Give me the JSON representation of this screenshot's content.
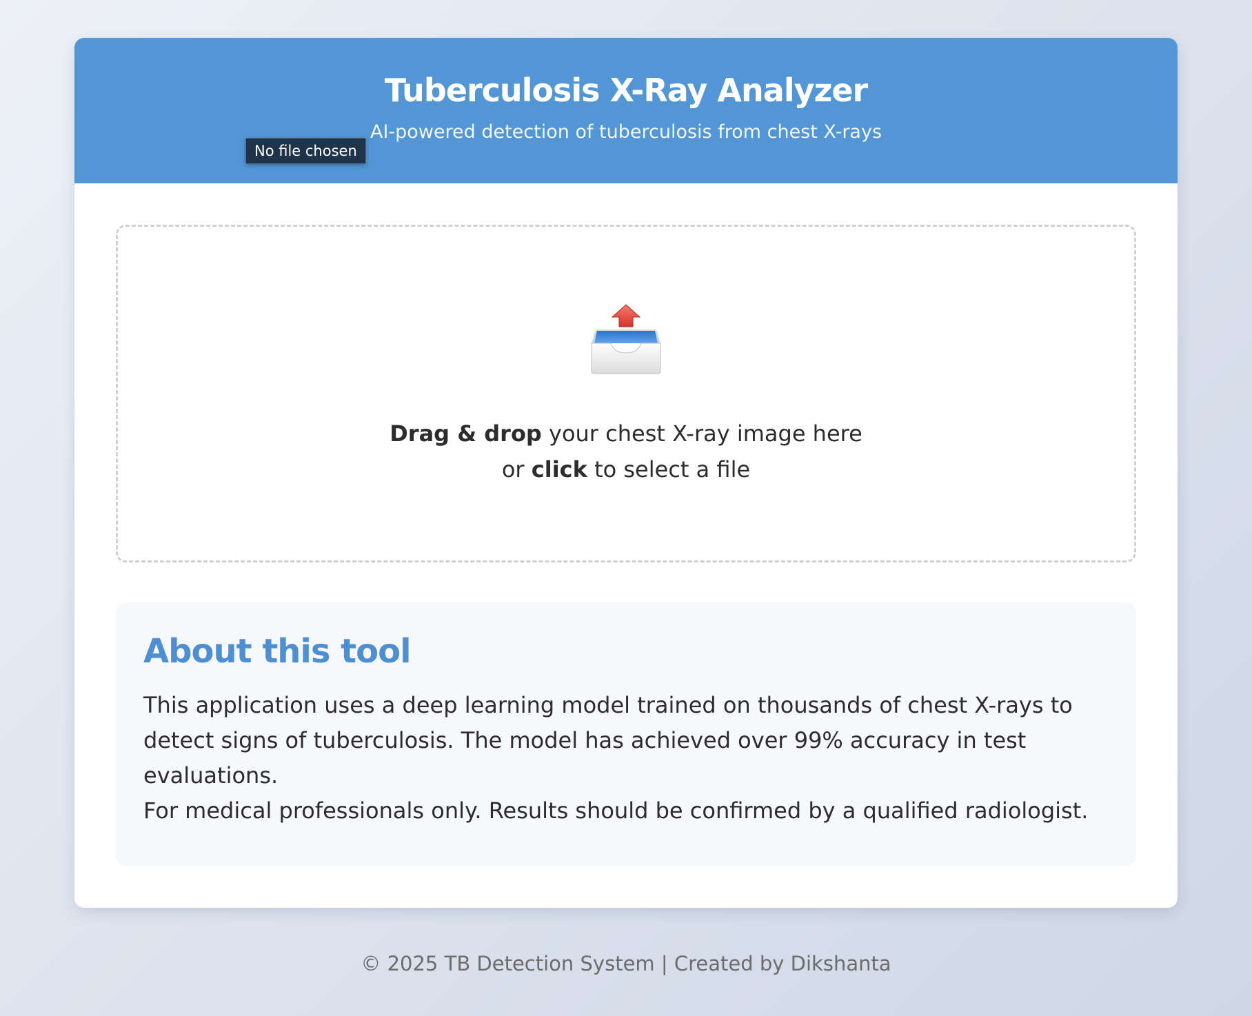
{
  "header": {
    "title": "Tuberculosis X-Ray Analyzer",
    "subtitle": "AI-powered detection of tuberculosis from chest X-rays"
  },
  "file_input": {
    "tooltip": "No file chosen"
  },
  "dropzone": {
    "icon": "inbox-upload-icon",
    "drag_bold": "Drag & drop",
    "drag_rest": " your chest X-ray image here",
    "or_text": "or ",
    "click_bold": "click",
    "click_rest": " to select a file"
  },
  "about": {
    "heading": "About this tool",
    "description": "This application uses a deep learning model trained on thousands of chest X-rays to detect signs of tuberculosis. The model has achieved over 99% accuracy in test evaluations.",
    "disclaimer": "For medical professionals only. Results should be confirmed by a qualified radiologist."
  },
  "footer": {
    "text": "© 2025 TB Detection System | Created by Dikshanta"
  },
  "colors": {
    "header_bg": "#5296d5",
    "accent": "#4d8fd2",
    "tooltip_bg": "#1f3448"
  }
}
